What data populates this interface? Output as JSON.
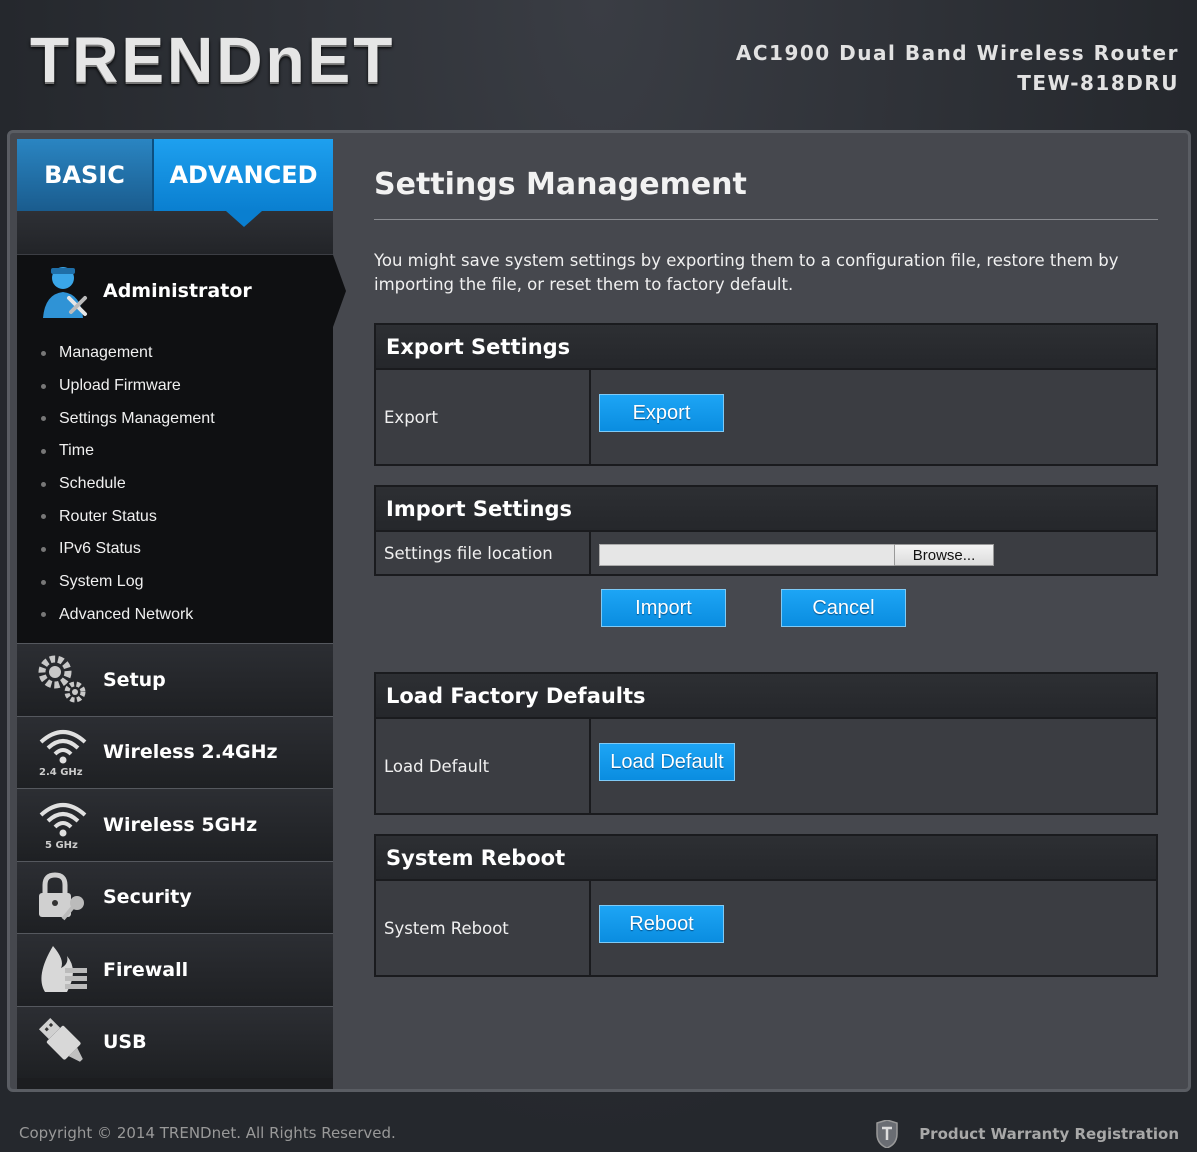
{
  "header": {
    "logo_text": "TRENDnET",
    "product_line1": "AC1900 Dual Band Wireless Router",
    "product_line2": "TEW-818DRU"
  },
  "tabs": [
    {
      "label": "BASIC",
      "active": false
    },
    {
      "label": "ADVANCED",
      "active": true
    }
  ],
  "sidebar": {
    "section_title": "Administrator",
    "section_icon": "administrator-icon",
    "submenu": [
      "Management",
      "Upload Firmware",
      "Settings Management",
      "Time",
      "Schedule",
      "Router Status",
      "IPv6 Status",
      "System Log",
      "Advanced Network"
    ],
    "nav": [
      {
        "label": "Setup",
        "icon": "gears-icon",
        "sub": ""
      },
      {
        "label": "Wireless 2.4GHz",
        "icon": "wifi-icon",
        "sub": "2.4 GHz"
      },
      {
        "label": "Wireless 5GHz",
        "icon": "wifi-icon",
        "sub": "5 GHz"
      },
      {
        "label": "Security",
        "icon": "lock-key-icon",
        "sub": ""
      },
      {
        "label": "Firewall",
        "icon": "firewall-icon",
        "sub": ""
      },
      {
        "label": "USB",
        "icon": "usb-icon",
        "sub": ""
      }
    ]
  },
  "main": {
    "title": "Settings Management",
    "intro": "You might save system settings by exporting them to a configuration file, restore them by importing the file, or reset them to factory default.",
    "export": {
      "heading": "Export Settings",
      "label": "Export",
      "button": "Export"
    },
    "import": {
      "heading": "Import Settings",
      "label": "Settings file location",
      "file_value": "",
      "browse_button": "Browse...",
      "import_button": "Import",
      "cancel_button": "Cancel"
    },
    "factory": {
      "heading": "Load Factory Defaults",
      "label": "Load Default",
      "button": "Load Default"
    },
    "reboot": {
      "heading": "System Reboot",
      "label": "System Reboot",
      "button": "Reboot"
    }
  },
  "footer": {
    "copyright": "Copyright © 2014 TRENDnet. All Rights Reserved.",
    "warranty": "Product Warranty Registration"
  },
  "colors": {
    "accent_blue": "#0a8de0",
    "background": "#2b2e34",
    "panel": "#3b3d42"
  }
}
